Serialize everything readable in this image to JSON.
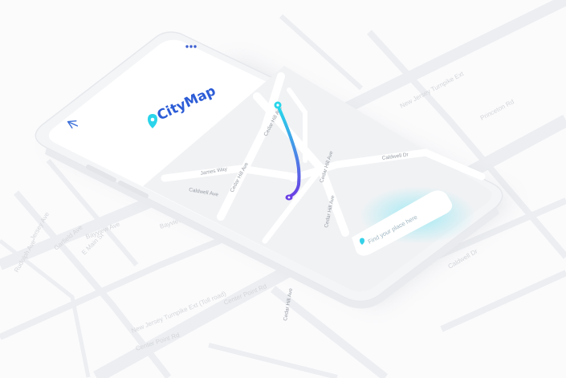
{
  "app": {
    "name": "CityMap",
    "back_icon": "arrow-left-icon",
    "menu_icon": "more-horizontal-icon",
    "brand_color": "#2c5cd6",
    "accent_color": "#34d1e8"
  },
  "search": {
    "placeholder": "Find your place here",
    "icon": "location-pin-icon"
  },
  "map": {
    "streets": [
      "James Way",
      "Cedar Hill Ave",
      "Caldwell Dr",
      "Cedar Hill Ave",
      "Cedar Hill Ave",
      "Cedar Hill Ave",
      "Cedar Hill Ave",
      "Caldwell Ave"
    ],
    "route": {
      "start_color": "#27d6ea",
      "end_color": "#6a3fe4"
    }
  },
  "background_map": {
    "streets": [
      "Bayview Ave",
      "Bayview Ave",
      "Garfield Ave",
      "Jersey Ave",
      "Rudolph Ave",
      "E Main St",
      "New Jersey Turnpike Ext (Toll road)",
      "New Jersey Turnpike Ext",
      "Center Point Rd",
      "Center Point Rd",
      "Caldwell Dr",
      "Princeton Rd"
    ]
  }
}
